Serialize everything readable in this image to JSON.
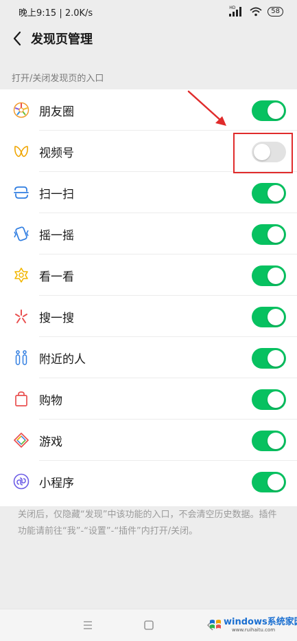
{
  "status_bar": {
    "time_speed": "晚上9:15 | 2.0K/s",
    "signal": "HD",
    "battery": "58"
  },
  "header": {
    "title": "发现页管理"
  },
  "section": {
    "header": "打开/关闭发现页的入口"
  },
  "items": [
    {
      "label": "朋友圈",
      "icon": "moments-icon",
      "enabled": true
    },
    {
      "label": "视频号",
      "icon": "channels-icon",
      "enabled": false
    },
    {
      "label": "扫一扫",
      "icon": "scan-icon",
      "enabled": true
    },
    {
      "label": "摇一摇",
      "icon": "shake-icon",
      "enabled": true
    },
    {
      "label": "看一看",
      "icon": "top-stories-icon",
      "enabled": true
    },
    {
      "label": "搜一搜",
      "icon": "search-icon",
      "enabled": true
    },
    {
      "label": "附近的人",
      "icon": "people-nearby-icon",
      "enabled": true
    },
    {
      "label": "购物",
      "icon": "shopping-bag-icon",
      "enabled": true
    },
    {
      "label": "游戏",
      "icon": "games-icon",
      "enabled": true
    },
    {
      "label": "小程序",
      "icon": "mini-programs-icon",
      "enabled": true
    }
  ],
  "footer": {
    "note": "关闭后，仅隐藏“发现”中该功能的入口，不会清空历史数据。插件功能请前往“我”-“设置”-“插件”内打开/关闭。"
  },
  "system_nav": {
    "menu": "menu-icon",
    "home": "home-icon",
    "back": "back-icon"
  },
  "watermark": {
    "brand": "windows系统家园",
    "site": "www.ruihaitu.com"
  },
  "colors": {
    "toggle_on": "#07c160",
    "toggle_off": "#e2e2e2",
    "annotation": "#e02b2b",
    "background": "#ededed"
  }
}
